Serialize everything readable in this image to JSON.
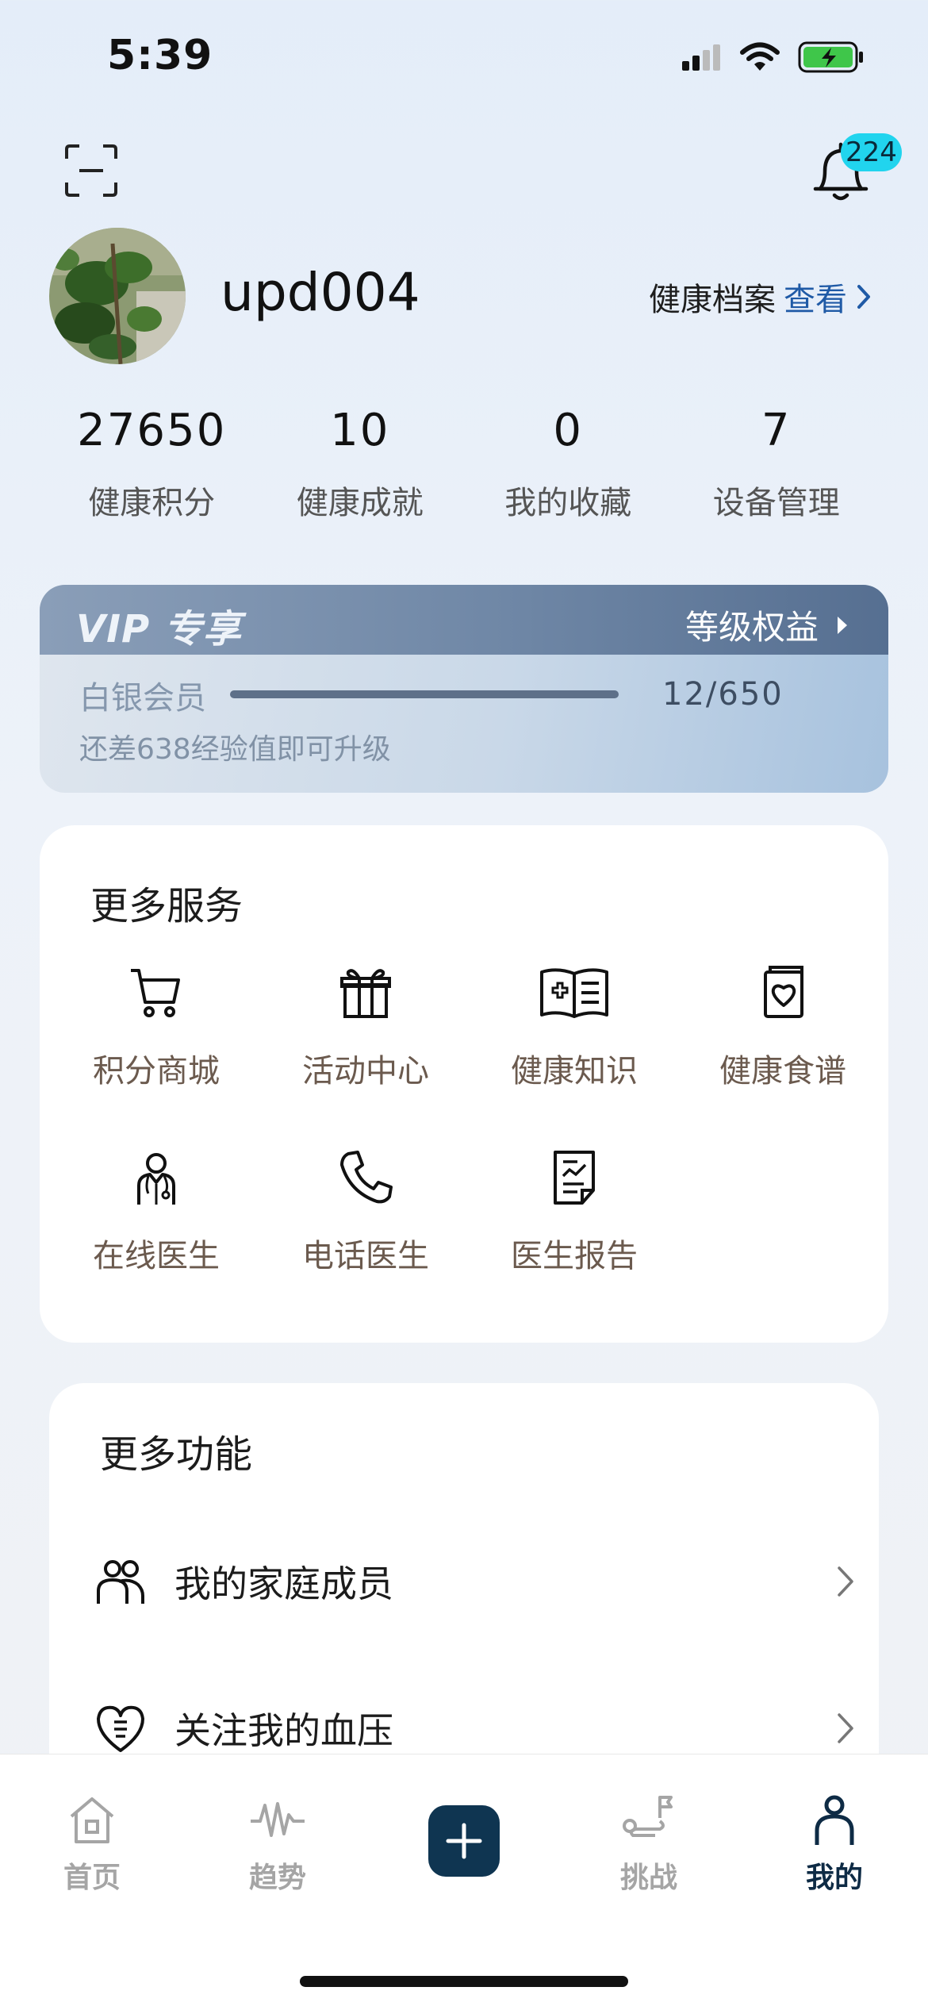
{
  "status_bar": {
    "time": "5:39"
  },
  "header": {
    "notification_count": "224"
  },
  "profile": {
    "username": "upd004",
    "health_record_label": "健康档案",
    "health_record_link": "查看"
  },
  "stats": [
    {
      "value": "27650",
      "label": "健康积分"
    },
    {
      "value": "10",
      "label": "健康成就"
    },
    {
      "value": "0",
      "label": "我的收藏"
    },
    {
      "value": "7",
      "label": "设备管理"
    }
  ],
  "vip": {
    "logo": "VIP 专享",
    "rights_label": "等级权益",
    "level": "白银会员",
    "progress_text": "12/650",
    "progress_fraction": 0.018,
    "hint": "还差638经验值即可升级"
  },
  "services": {
    "title": "更多服务",
    "items": [
      {
        "label": "积分商城",
        "icon": "cart-icon"
      },
      {
        "label": "活动中心",
        "icon": "gift-icon"
      },
      {
        "label": "健康知识",
        "icon": "medical-book-icon"
      },
      {
        "label": "健康食谱",
        "icon": "heart-recipe-icon"
      },
      {
        "label": "在线医生",
        "icon": "doctor-icon"
      },
      {
        "label": "电话医生",
        "icon": "phone-icon"
      },
      {
        "label": "医生报告",
        "icon": "report-icon"
      }
    ]
  },
  "functions": {
    "title": "更多功能",
    "items": [
      {
        "label": "我的家庭成员",
        "icon": "family-icon"
      },
      {
        "label": "关注我的血压",
        "icon": "heart-pressure-icon"
      }
    ]
  },
  "tabbar": {
    "items": [
      {
        "label": "首页",
        "icon": "home-icon",
        "active": false
      },
      {
        "label": "趋势",
        "icon": "pulse-icon",
        "active": false
      },
      {
        "label": "挑战",
        "icon": "flag-route-icon",
        "active": false
      },
      {
        "label": "我的",
        "icon": "person-icon",
        "active": true
      }
    ]
  },
  "colors": {
    "accent": "#0f3551",
    "badge": "#21d4ee",
    "link": "#1f5aa6",
    "service_label": "#6b5a4e"
  }
}
